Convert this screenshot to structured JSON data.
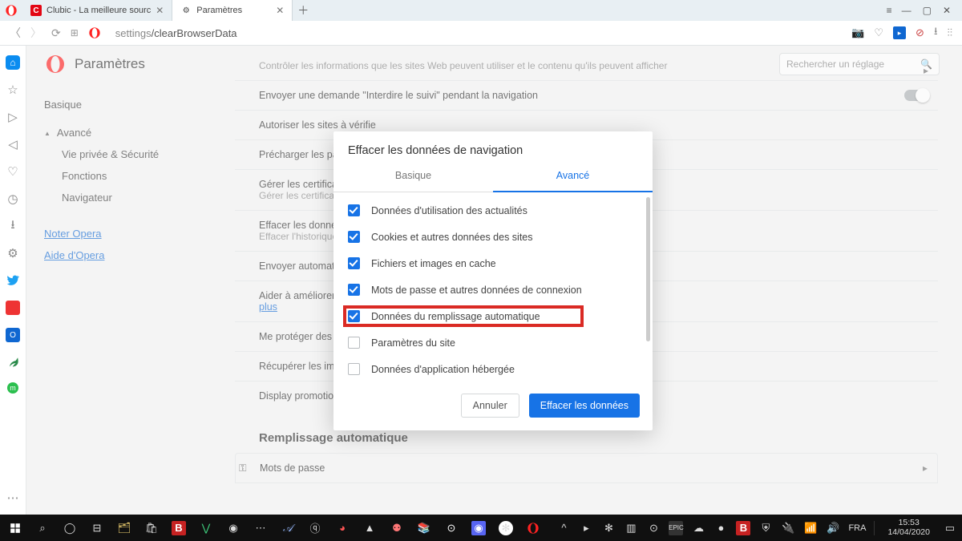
{
  "tabs": {
    "clubic": "Clubic - La meilleure sourc",
    "settings": "Paramètres"
  },
  "addressbar": {
    "prefix": "settings",
    "path": "/clearBrowserData"
  },
  "header": {
    "title": "Paramètres",
    "search_placeholder": "Rechercher un réglage"
  },
  "sidenav": {
    "basic": "Basique",
    "advanced": "Avancé",
    "privacy": "Vie privée & Sécurité",
    "features": "Fonctions",
    "browser": "Navigateur",
    "rate": "Noter Opera",
    "help": "Aide d'Opera"
  },
  "rows": {
    "r0_sub": "Contrôler les informations que les sites Web peuvent utiliser et le contenu qu'ils peuvent afficher",
    "r1": "Envoyer une demande \"Interdire le suivi\" pendant la navigation",
    "r2": "Autoriser les sites à vérifie",
    "r3": "Précharger les pages pour",
    "r4_cap": "Gérer les certificats",
    "r4_sub": "Gérer les certifications et p",
    "r5_cap": "Effacer les données de na",
    "r5_sub": "Effacer l'historique, les coo",
    "r6": "Envoyer automatiquement",
    "r7": "Aider à améliorer Opera e",
    "r7_link": "plus",
    "r8": "Me protéger des sites mal",
    "r9": "Récupérer les images des",
    "r10": "Display promotional notifi",
    "section_autofill": "Remplissage automatique",
    "r11": "Mots de passe"
  },
  "dialog": {
    "title": "Effacer les données de navigation",
    "tab_basic": "Basique",
    "tab_adv": "Avancé",
    "opts": {
      "news": "Données d'utilisation des actualités",
      "cookies": "Cookies et autres données des sites",
      "cache": "Fichiers et images en cache",
      "passwords": "Mots de passe et autres données de connexion",
      "autofill": "Données du remplissage automatique",
      "site": "Paramètres du site",
      "hosted": "Données d'application hébergée"
    },
    "cancel": "Annuler",
    "confirm": "Effacer les données"
  },
  "tray": {
    "lang": "FRA",
    "time": "15:53",
    "date": "14/04/2020"
  }
}
